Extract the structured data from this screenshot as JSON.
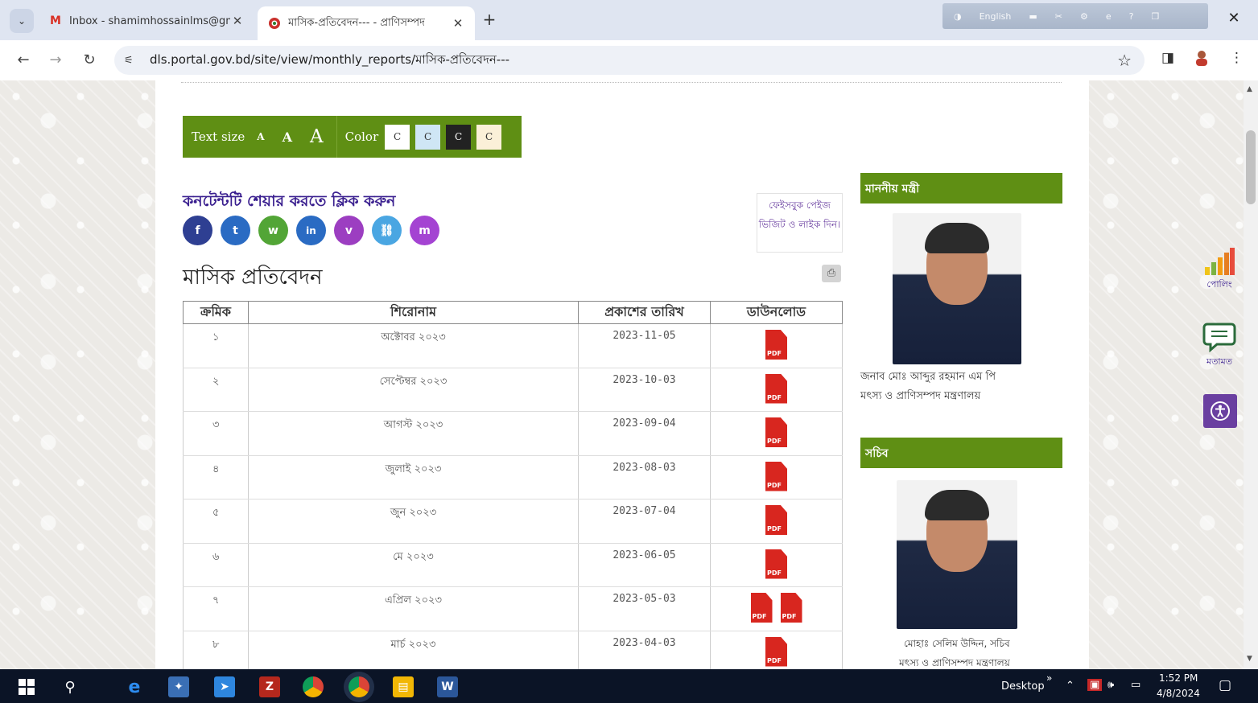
{
  "browser": {
    "tabs": [
      {
        "title": "Inbox - shamimhossainlms@gm",
        "favicon": "gmail-icon"
      },
      {
        "title": "মাসিক-প্রতিবেদন--- - প্রাণিসম্পদ",
        "favicon": "govt-seal-icon"
      }
    ],
    "extension_bar_label": "English",
    "url": "dls.portal.gov.bd/site/view/monthly_reports/মাসিক-প্রতিবেদন---"
  },
  "accessibility": {
    "text_size_label": "Text size",
    "size_small": "A",
    "size_medium": "A",
    "size_large": "A",
    "color_label": "Color",
    "color_buttons": [
      "C",
      "C",
      "C",
      "C"
    ],
    "color_swatches": [
      "#ffffff",
      "#cfe6f5",
      "#222222",
      "#fbf0d8"
    ],
    "bar_color": "#5f8f14"
  },
  "share": {
    "title": "কনটেন্টটি শেয়ার করতে ক্লিক করুন",
    "buttons": [
      {
        "name": "facebook",
        "glyph": "f",
        "color": "#2e3f92"
      },
      {
        "name": "twitter",
        "glyph": "t",
        "color": "#2a6bc3"
      },
      {
        "name": "whatsapp",
        "glyph": "w",
        "color": "#52a536"
      },
      {
        "name": "linkedin",
        "glyph": "in",
        "color": "#2a6bc3"
      },
      {
        "name": "viber",
        "glyph": "v",
        "color": "#9c3ec1"
      },
      {
        "name": "link",
        "glyph": "⛓",
        "color": "#4aa6e2"
      },
      {
        "name": "messenger",
        "glyph": "m",
        "color": "#a443d2"
      }
    ],
    "facebook_box": "ফেইসবুক পেইজ ভিজিট ও লাইক দিন।"
  },
  "page": {
    "title": "মাসিক প্রতিবেদন"
  },
  "table": {
    "headers": [
      "ক্রমিক",
      "শিরোনাম",
      "প্রকাশের তারিখ",
      "ডাউনলোড"
    ],
    "rows": [
      {
        "serial": "১",
        "title": "অক্টোবর ২০২৩",
        "date": "2023-11-05",
        "pdf_count": 1
      },
      {
        "serial": "২",
        "title": "সেপ্টেম্বর ২০২৩",
        "date": "2023-10-03",
        "pdf_count": 1
      },
      {
        "serial": "৩",
        "title": "আগস্ট ২০২৩",
        "date": "2023-09-04",
        "pdf_count": 1
      },
      {
        "serial": "৪",
        "title": "জুলাই ২০২৩",
        "date": "2023-08-03",
        "pdf_count": 1
      },
      {
        "serial": "৫",
        "title": "জুন ২০২৩",
        "date": "2023-07-04",
        "pdf_count": 1
      },
      {
        "serial": "৬",
        "title": "মে ২০২৩",
        "date": "2023-06-05",
        "pdf_count": 1
      },
      {
        "serial": "৭",
        "title": "এপ্রিল ২০২৩",
        "date": "2023-05-03",
        "pdf_count": 2
      },
      {
        "serial": "৮",
        "title": "মার্চ ২০২৩",
        "date": "2023-04-03",
        "pdf_count": 1
      }
    ],
    "pdf_label": "PDF"
  },
  "sidebar": {
    "minister_header": "মাননীয় মন্ত্রী",
    "minister_name": "জনাব মোঃ আব্দুর রহমান এম পি",
    "minister_ministry": "মৎস্য ও প্রাণিসম্পদ মন্ত্রণালয়",
    "secretary_header": "সচিব",
    "secretary_name": "মোহাঃ সেলিম উদ্দিন, সচিব",
    "secretary_ministry": "মৎস্য ও প্রাণিসম্পদ মন্ত্রণালয়"
  },
  "floating": {
    "poll_label": "পোলিং",
    "feedback_label": "মতামত"
  },
  "taskbar": {
    "desktop_label": "Desktop",
    "time": "1:52 PM",
    "date": "4/8/2024"
  }
}
